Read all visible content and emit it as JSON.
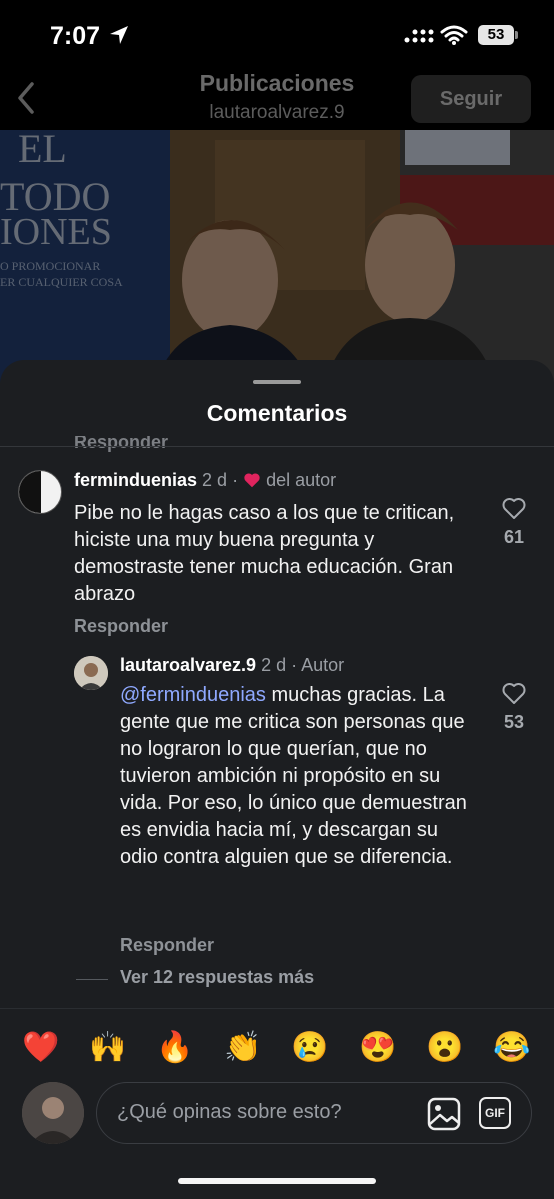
{
  "status_bar": {
    "time": "7:07",
    "battery": "53"
  },
  "header": {
    "title": "Publicaciones",
    "subtitle": "lautaroalvarez.9",
    "follow_label": "Seguir"
  },
  "post_image": {
    "book_text_1": "EL",
    "book_text_2": "TODO",
    "book_text_3": "IONES",
    "book_text_4": "O PROMOCIONAR",
    "book_text_5": "ER CUALQUIER COSA"
  },
  "sheet": {
    "title": "Comentarios",
    "cut_reply_label": "Responder"
  },
  "comment": {
    "username": "ferminduenias",
    "age": "2 d",
    "separator": "·",
    "liked_by_author": "del autor",
    "text": "Pibe no le hagas caso a los que te critican, hiciste una muy buena pregunta y demostraste tener mucha educación. Gran abrazo",
    "reply_label": "Responder",
    "likes": "61"
  },
  "reply": {
    "username": "lautaroalvarez.9",
    "age": "2 d",
    "separator": "·",
    "author_badge": "Autor",
    "mention": "@ferminduenias",
    "text": " muchas gracias. La gente que me critica son personas que no lograron lo que querían, que no tuvieron ambición ni propósito en su vida. Por eso, lo único que demuestran es envidia hacia mí, y descargan su odio contra alguien que se diferencia.",
    "reply_label": "Responder",
    "likes": "53"
  },
  "more_replies": "Ver 12 respuestas más",
  "quick_reactions": [
    "❤️",
    "🙌",
    "🔥",
    "👏",
    "😢",
    "😍",
    "😮",
    "😂"
  ],
  "composer": {
    "placeholder": "¿Qué opinas sobre esto?",
    "gif_label": "GIF"
  },
  "colors": {
    "accent_mention": "#8fa9ff",
    "heart": "#e0245e",
    "sheet_bg": "#1c1e21"
  }
}
